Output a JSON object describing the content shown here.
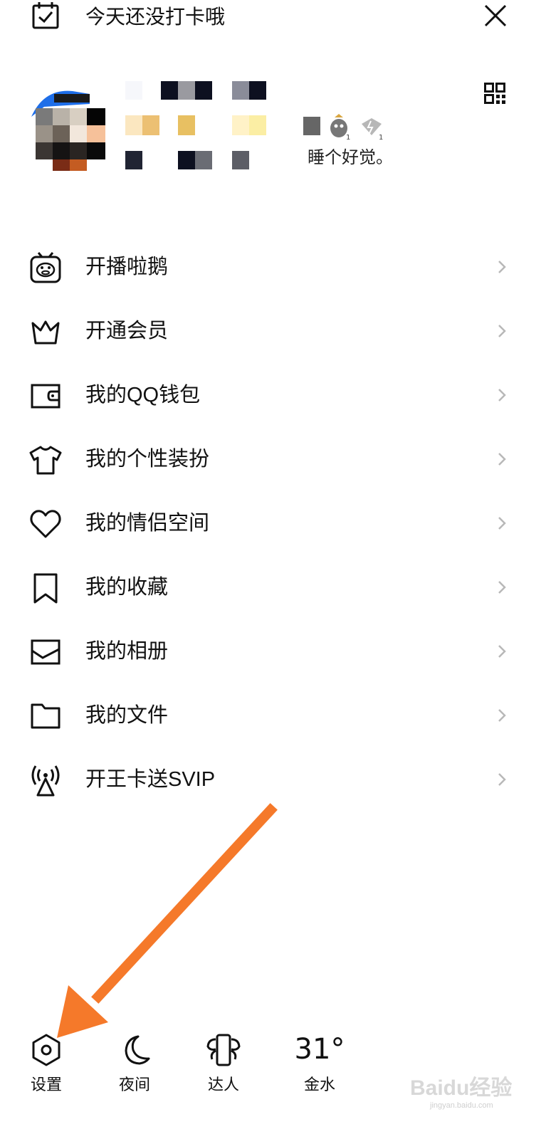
{
  "header": {
    "checkin_text": "今天还没打卡哦",
    "checkin_icon": "calendar-check-icon",
    "close_icon": "close-icon"
  },
  "profile": {
    "signature": "睡个好觉。",
    "qr_icon": "qr-code-icon"
  },
  "menu": {
    "items": [
      {
        "label": "开播啦鹅",
        "icon": "tv-mascot-icon"
      },
      {
        "label": "开通会员",
        "icon": "crown-icon"
      },
      {
        "label": "我的QQ钱包",
        "icon": "wallet-icon"
      },
      {
        "label": "我的个性装扮",
        "icon": "tshirt-icon"
      },
      {
        "label": "我的情侣空间",
        "icon": "heart-icon"
      },
      {
        "label": "我的收藏",
        "icon": "bookmark-icon"
      },
      {
        "label": "我的相册",
        "icon": "photo-icon"
      },
      {
        "label": "我的文件",
        "icon": "folder-icon"
      },
      {
        "label": "开王卡送SVIP",
        "icon": "signal-tower-icon"
      }
    ]
  },
  "bottom": {
    "settings_label": "设置",
    "night_label": "夜间",
    "expert_label": "达人",
    "weather_temp": "31°",
    "weather_label": "金水"
  },
  "watermark": {
    "main": "Baidu经验",
    "sub": "jingyan.baidu.com"
  },
  "colors": {
    "arrow": "#f5792a",
    "text": "#111111",
    "chevron": "#b8b8b8"
  }
}
